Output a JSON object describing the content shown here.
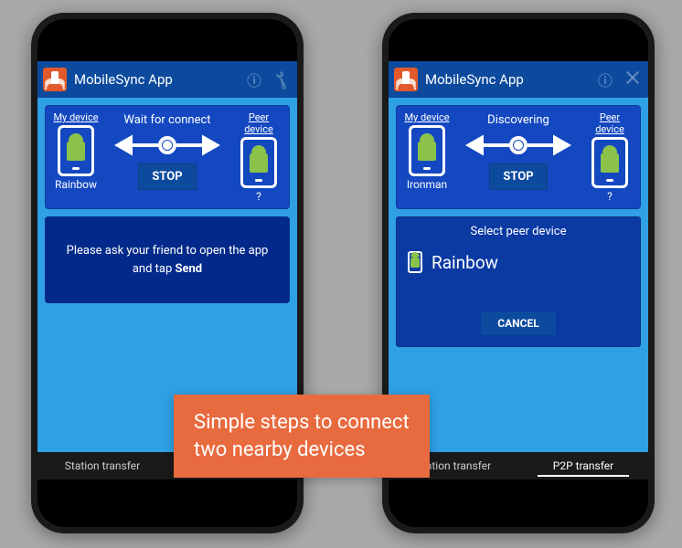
{
  "app": {
    "title": "MobileSync App"
  },
  "icons": {
    "info": "ⓘ",
    "wrench": "🔧"
  },
  "left_phone": {
    "my_device_label": "My device",
    "peer_device_label": "Peer device",
    "status": "Wait for connect",
    "stop_label": "STOP",
    "my_device_name": "Rainbow",
    "peer_device_name": "?",
    "message_prefix": "Please ask your friend to open the app and tap ",
    "message_bold": "Send"
  },
  "right_phone": {
    "my_device_label": "My device",
    "peer_device_label": "Peer device",
    "status": "Discovering",
    "stop_label": "STOP",
    "my_device_name": "Ironman",
    "peer_device_name": "?",
    "dialog_title": "Select peer device",
    "peer_list": [
      {
        "name": "Rainbow"
      }
    ],
    "cancel_label": "CANCEL"
  },
  "tabs": {
    "station": "Station transfer",
    "p2p": "P2P transfer",
    "active": "p2p"
  },
  "banner": {
    "line1": "Simple steps to connect",
    "line2": "two nearby devices"
  },
  "colors": {
    "background": "#a9a9a9",
    "appbar": "#0c4a9e",
    "panel": "#1448c1",
    "screen": "#2fa0e4",
    "banner": "#e86a3f"
  }
}
